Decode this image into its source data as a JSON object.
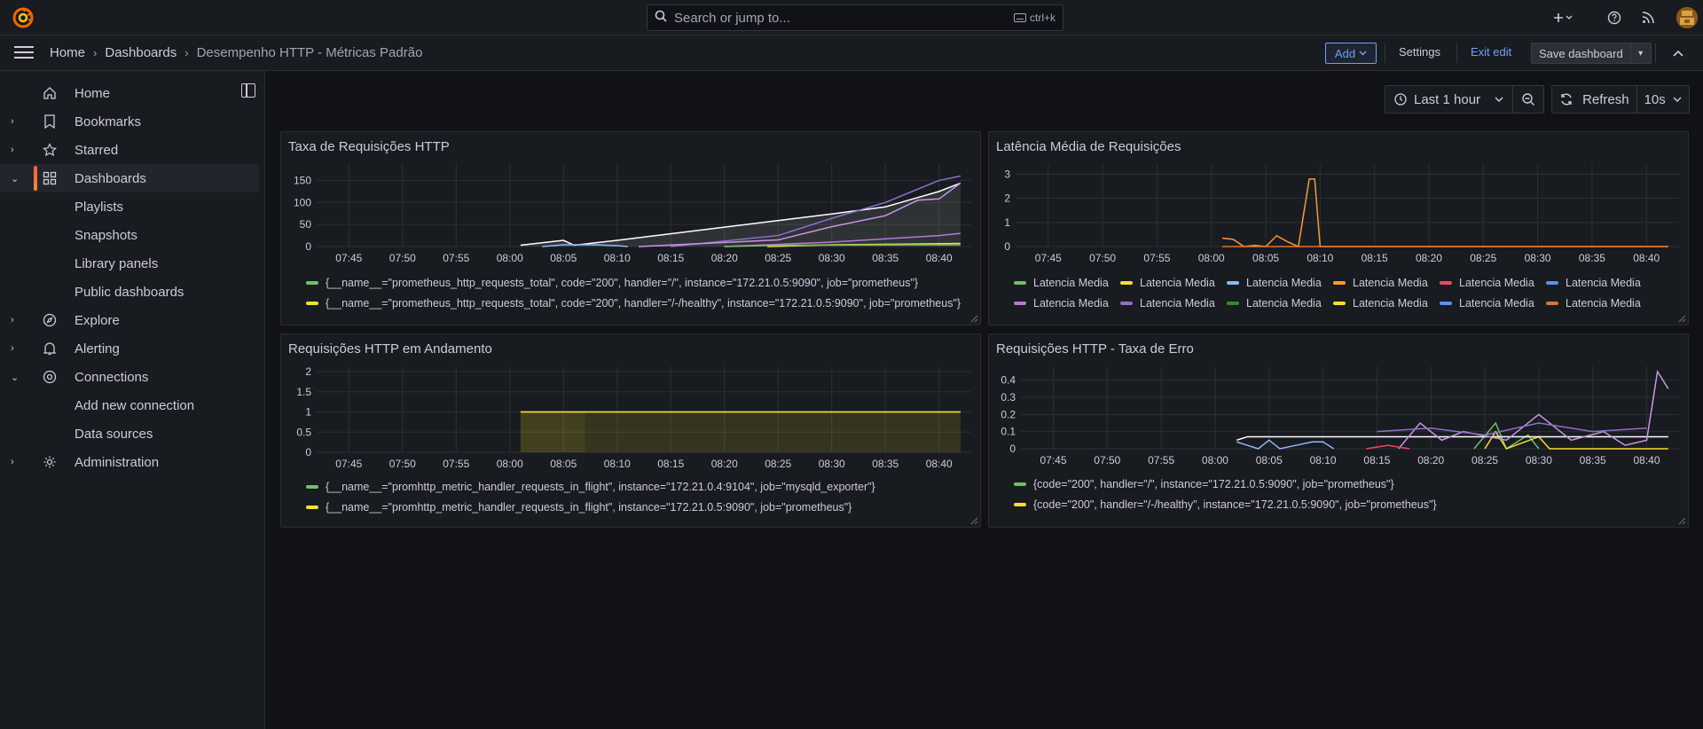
{
  "search": {
    "placeholder": "Search or jump to...",
    "shortcut": "ctrl+k"
  },
  "breadcrumb": {
    "home": "Home",
    "dashboards": "Dashboards",
    "current": "Desempenho HTTP - Métricas Padrão"
  },
  "toolbar": {
    "add": "Add",
    "settings": "Settings",
    "exit_edit": "Exit edit",
    "save": "Save dashboard"
  },
  "sidebar": {
    "items": [
      {
        "label": "Home",
        "icon": "home-icon"
      },
      {
        "label": "Bookmarks",
        "icon": "bookmark-icon"
      },
      {
        "label": "Starred",
        "icon": "star-icon"
      },
      {
        "label": "Dashboards",
        "icon": "apps-icon"
      },
      {
        "label": "Playlists"
      },
      {
        "label": "Snapshots"
      },
      {
        "label": "Library panels"
      },
      {
        "label": "Public dashboards"
      },
      {
        "label": "Explore",
        "icon": "compass-icon"
      },
      {
        "label": "Alerting",
        "icon": "bell-icon"
      },
      {
        "label": "Connections",
        "icon": "connections-icon"
      },
      {
        "label": "Add new connection"
      },
      {
        "label": "Data sources"
      },
      {
        "label": "Administration",
        "icon": "cog-icon"
      }
    ]
  },
  "timepicker": {
    "range": "Last 1 hour",
    "refresh": "Refresh",
    "interval": "10s"
  },
  "colors": {
    "green": "#73bf69",
    "yellow": "#fade2a",
    "blue": "#8ab8ff",
    "orange": "#ff9830",
    "red": "#f2495c",
    "blue2": "#5794f2",
    "purple": "#b877d9",
    "purple2": "#8f6fd0",
    "darkgreen": "#37872d",
    "lavender": "#ca95e5",
    "darkorange": "#e0752d"
  },
  "panels": [
    {
      "title": "Taxa de Requisições HTTP",
      "legend": [
        "{__name__=\"prometheus_http_requests_total\", code=\"200\", handler=\"/\", instance=\"172.21.0.5:9090\", job=\"prometheus\"}",
        "{__name__=\"prometheus_http_requests_total\", code=\"200\", handler=\"/-/healthy\", instance=\"172.21.0.5:9090\", job=\"prometheus\"}"
      ]
    },
    {
      "title": "Latência Média de Requisições",
      "legend": [
        "Latencia Media",
        "Latencia Media",
        "Latencia Media",
        "Latencia Media",
        "Latencia Media",
        "Latencia Media",
        "Latencia Media",
        "Latencia Media",
        "Latencia Media",
        "Latencia Media",
        "Latencia Media",
        "Latencia Media"
      ]
    },
    {
      "title": "Requisições HTTP em Andamento",
      "legend": [
        "{__name__=\"promhttp_metric_handler_requests_in_flight\", instance=\"172.21.0.4:9104\", job=\"mysqld_exporter\"}",
        "{__name__=\"promhttp_metric_handler_requests_in_flight\", instance=\"172.21.0.5:9090\", job=\"prometheus\"}"
      ]
    },
    {
      "title": "Requisições HTTP - Taxa de Erro",
      "legend": [
        "{code=\"200\", handler=\"/\", instance=\"172.21.0.5:9090\", job=\"prometheus\"}",
        "{code=\"200\", handler=\"/-/healthy\", instance=\"172.21.0.5:9090\", job=\"prometheus\"}"
      ]
    }
  ],
  "chart_data": [
    {
      "type": "line",
      "title": "Taxa de Requisições HTTP",
      "x_ticks": [
        "07:45",
        "07:50",
        "07:55",
        "08:00",
        "08:05",
        "08:10",
        "08:15",
        "08:20",
        "08:25",
        "08:30",
        "08:35",
        "08:40"
      ],
      "y_ticks": [
        "0",
        "50",
        "100",
        "150"
      ],
      "ylim": [
        0,
        175
      ],
      "series": [
        {
          "name": "{__name__=\"prometheus_http_requests_total\", code=\"200\", handler=\"/\", instance=\"172.21.0.5:9090\", job=\"prometheus\"}",
          "color": "#ffffff",
          "x": [
            "08:01",
            "08:05",
            "08:06",
            "08:10",
            "08:20",
            "08:30",
            "08:35",
            "08:40",
            "08:42"
          ],
          "y": [
            3,
            14,
            3,
            14,
            44,
            74,
            90,
            125,
            144
          ]
        },
        {
          "color": "#8f6fd0",
          "x": [
            "08:15",
            "08:25",
            "08:30",
            "08:35",
            "08:40",
            "08:42"
          ],
          "y": [
            0,
            25,
            64,
            100,
            150,
            160
          ]
        },
        {
          "color": "#ca95e5",
          "x": [
            "08:12",
            "08:25",
            "08:30",
            "08:35",
            "08:38",
            "08:40",
            "08:42"
          ],
          "y": [
            0,
            15,
            45,
            70,
            105,
            108,
            144
          ]
        },
        {
          "color": "#b877d9",
          "x": [
            "08:20",
            "08:30",
            "08:40",
            "08:42"
          ],
          "y": [
            0,
            10,
            25,
            30
          ]
        },
        {
          "color": "#8ab8ff",
          "x": [
            "08:03",
            "08:05",
            "08:08",
            "08:10",
            "08:11"
          ],
          "y": [
            0,
            4,
            4,
            2,
            0
          ]
        },
        {
          "name": "{__name__=\"prometheus_http_requests_total\", code=\"200\", handler=\"/-/healthy\", instance=\"172.21.0.5:9090\", job=\"prometheus\"}",
          "color": "#fade2a",
          "x": [
            "08:24",
            "08:30",
            "08:42"
          ],
          "y": [
            0,
            4,
            7
          ]
        },
        {
          "color": "#73bf69",
          "x": [
            "08:20",
            "08:25",
            "08:42"
          ],
          "y": [
            0,
            3,
            4
          ]
        }
      ]
    },
    {
      "type": "line",
      "title": "Latência Média de Requisições",
      "x_ticks": [
        "07:45",
        "07:50",
        "07:55",
        "08:00",
        "08:05",
        "08:10",
        "08:15",
        "08:20",
        "08:25",
        "08:30",
        "08:35",
        "08:40"
      ],
      "y_ticks": [
        "0",
        "1",
        "2",
        "3"
      ],
      "ylim": [
        0,
        3.2
      ],
      "series": [
        {
          "name": "Latencia Media",
          "color": "#ff9830",
          "x": [
            "08:01",
            "08:02",
            "08:03",
            "08:04",
            "08:05",
            "08:06",
            "08:07",
            "08:08",
            "08:09",
            "08:09.5",
            "08:10",
            "08:42"
          ],
          "y": [
            0.35,
            0.3,
            0,
            0.05,
            0,
            0.45,
            0.2,
            0,
            2.8,
            2.8,
            0,
            0
          ]
        },
        {
          "name": "Latencia Media",
          "color": "#e0752d",
          "x": [
            "08:01",
            "08:42"
          ],
          "y": [
            0,
            0
          ]
        }
      ]
    },
    {
      "type": "area",
      "title": "Requisições HTTP em Andamento",
      "x_ticks": [
        "07:45",
        "07:50",
        "07:55",
        "08:00",
        "08:05",
        "08:10",
        "08:15",
        "08:20",
        "08:25",
        "08:30",
        "08:35",
        "08:40"
      ],
      "y_ticks": [
        "0",
        "0.5",
        "1",
        "1.5",
        "2"
      ],
      "ylim": [
        0,
        2
      ],
      "series": [
        {
          "name": "{__name__=\"promhttp_metric_handler_requests_in_flight\", instance=\"172.21.0.4:9104\", job=\"mysqld_exporter\"}",
          "color": "#73bf69",
          "x": [
            "08:01",
            "08:42"
          ],
          "y": [
            1,
            1
          ]
        },
        {
          "name": "{__name__=\"promhttp_metric_handler_requests_in_flight\", instance=\"172.21.0.5:9090\", job=\"prometheus\"}",
          "color": "#fade2a",
          "x": [
            "08:01",
            "08:42"
          ],
          "y": [
            1,
            1
          ]
        }
      ]
    },
    {
      "type": "line",
      "title": "Requisições HTTP - Taxa de Erro",
      "x_ticks": [
        "07:45",
        "07:50",
        "07:55",
        "08:00",
        "08:05",
        "08:10",
        "08:15",
        "08:20",
        "08:25",
        "08:30",
        "08:35",
        "08:40"
      ],
      "y_ticks": [
        "0",
        "0.1",
        "0.2",
        "0.3",
        "0.4"
      ],
      "ylim": [
        0,
        0.45
      ],
      "series": [
        {
          "name": "{code=\"200\", handler=\"/\", instance=\"172.21.0.5:9090\", job=\"prometheus\"}",
          "color": "#73bf69",
          "x": [
            "08:24",
            "08:26",
            "08:27",
            "08:29",
            "08:30"
          ],
          "y": [
            0,
            0.15,
            0,
            0.08,
            0
          ]
        },
        {
          "name": "{code=\"200\", handler=\"/-/healthy\", instance=\"172.21.0.5:9090\", job=\"prometheus\"}",
          "color": "#fade2a",
          "x": [
            "08:25",
            "08:26",
            "08:27",
            "08:30",
            "08:31",
            "08:42"
          ],
          "y": [
            0,
            0.1,
            0,
            0.07,
            0,
            0
          ]
        },
        {
          "color": "#ffffff",
          "x": [
            "08:02",
            "08:03",
            "08:07",
            "08:08",
            "08:42"
          ],
          "y": [
            0.05,
            0.07,
            0.07,
            0.07,
            0.07
          ]
        },
        {
          "color": "#ca95e5",
          "x": [
            "08:17",
            "08:19",
            "08:21",
            "08:23",
            "08:27",
            "08:30",
            "08:33",
            "08:36",
            "08:38",
            "08:40",
            "08:41",
            "08:42"
          ],
          "y": [
            0,
            0.15,
            0.05,
            0.1,
            0.05,
            0.2,
            0.05,
            0.1,
            0.02,
            0.05,
            0.45,
            0.35
          ]
        },
        {
          "color": "#8f6fd0",
          "x": [
            "08:15",
            "08:20",
            "08:25",
            "08:30",
            "08:35",
            "08:40"
          ],
          "y": [
            0.1,
            0.12,
            0.08,
            0.15,
            0.1,
            0.12
          ]
        },
        {
          "color": "#8ab8ff",
          "x": [
            "08:02",
            "08:04",
            "08:05",
            "08:06",
            "08:09",
            "08:10",
            "08:11"
          ],
          "y": [
            0.04,
            0,
            0.05,
            0,
            0.04,
            0.04,
            0
          ]
        },
        {
          "color": "#f2495c",
          "x": [
            "08:14",
            "08:16",
            "08:18"
          ],
          "y": [
            0,
            0.02,
            0
          ]
        }
      ]
    }
  ]
}
